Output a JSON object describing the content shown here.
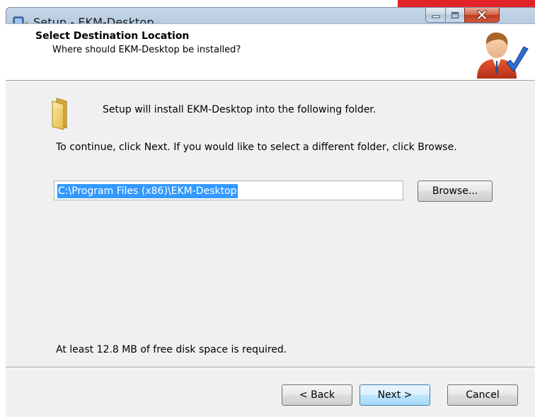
{
  "window": {
    "title": "Setup - EKM-Desktop"
  },
  "header": {
    "title": "Select Destination Location",
    "subtitle": "Where should EKM-Desktop be installed?"
  },
  "body": {
    "install_message": "Setup will install EKM-Desktop into the following folder.",
    "instruction": "To continue, click Next. If you would like to select a different folder, click Browse.",
    "destination_path": "C:\\Program Files (x86)\\EKM-Desktop",
    "browse_label": "Browse...",
    "disk_space": "At least 12.8 MB of free disk space is required."
  },
  "footer": {
    "back_label": "< Back",
    "next_label": "Next >",
    "cancel_label": "Cancel"
  },
  "icons": {
    "title": "setup-icon",
    "folder": "folder-icon",
    "wizard": "user-checkmark-icon"
  },
  "colors": {
    "selection": "#3399ff",
    "corner_accent": "#e2232a"
  }
}
